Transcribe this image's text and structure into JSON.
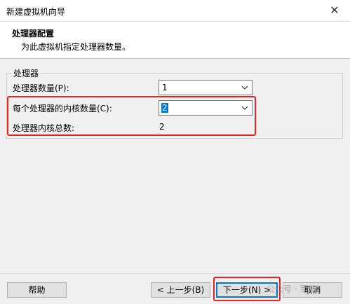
{
  "window": {
    "title": "新建虚拟机向导"
  },
  "header": {
    "title": "处理器配置",
    "subtitle": "为此虚拟机指定处理器数量。"
  },
  "group": {
    "legend": "处理器",
    "processor_count": {
      "label": "处理器数量(P):",
      "value": "1"
    },
    "cores_per_processor": {
      "label": "每个处理器的内核数量(C):",
      "value": "2"
    },
    "total_cores": {
      "label": "处理器内核总数:",
      "value": "2"
    }
  },
  "footer": {
    "help": "帮助",
    "back": "< 上一步(B)",
    "next": "下一步(N) >",
    "cancel": "取消"
  },
  "watermark": "公众号 · 军哥",
  "colors": {
    "accent": "#0078d7",
    "highlight": "#e8231f"
  }
}
